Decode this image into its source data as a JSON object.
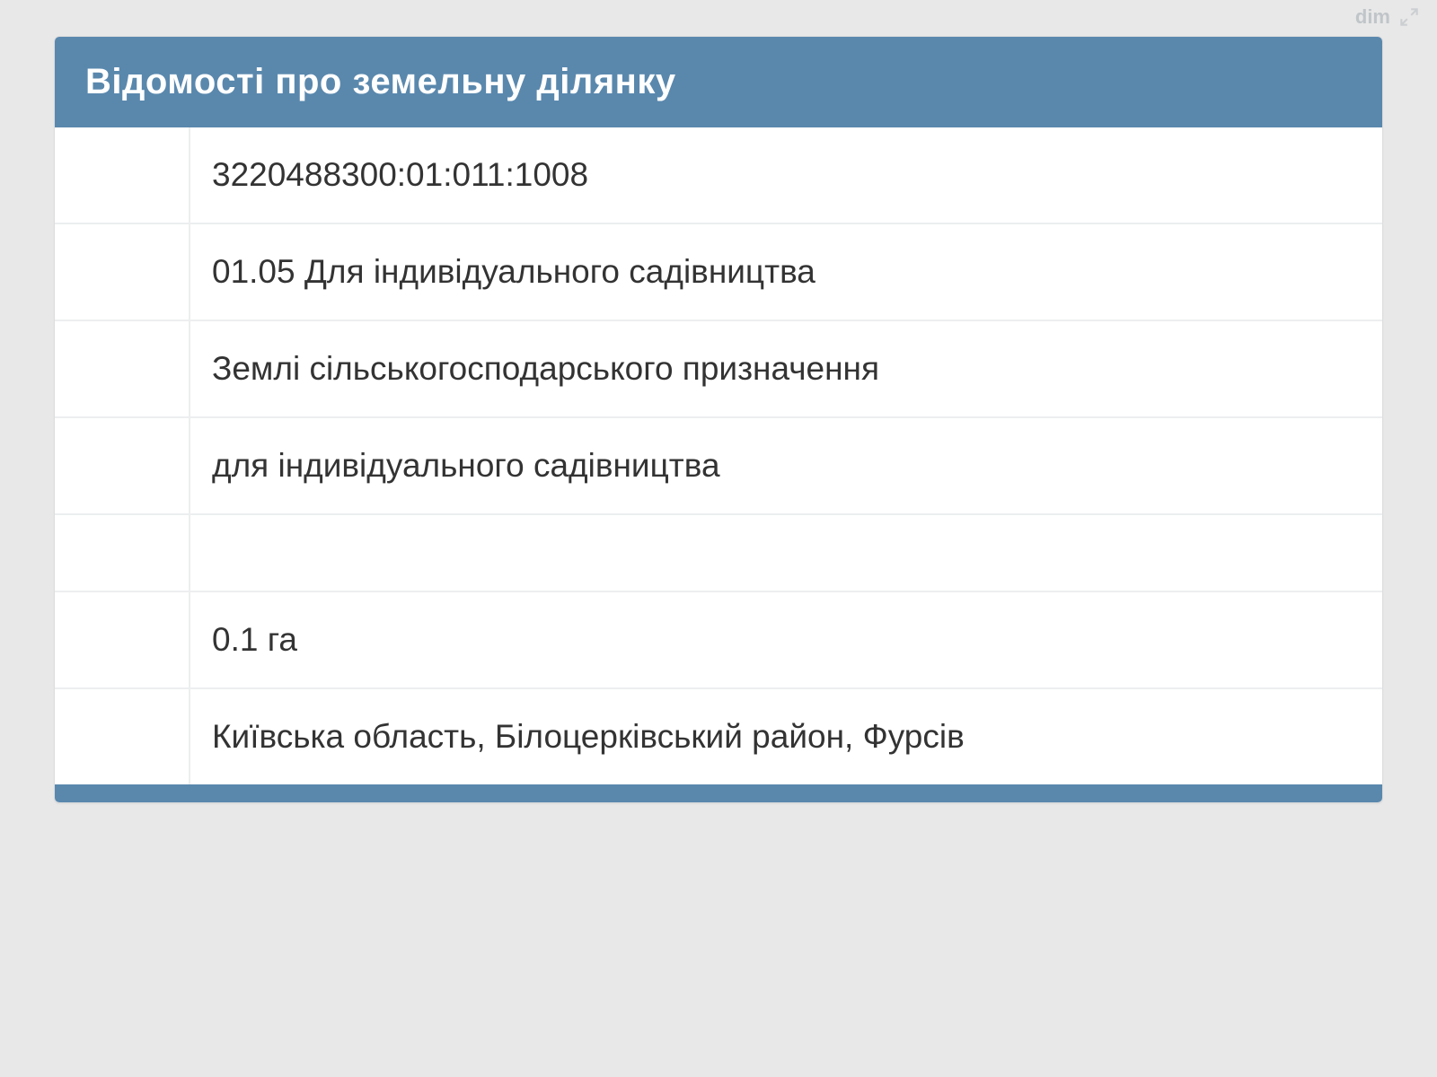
{
  "watermark": {
    "text": "dim"
  },
  "panel": {
    "title": "Відомості про земельну ділянку",
    "rows": [
      {
        "value": "3220488300:01:011:1008"
      },
      {
        "value": "01.05 Для індивідуального садівництва"
      },
      {
        "value": "Землі сільськогосподарського призначення"
      },
      {
        "value": "для індивідуального садівництва"
      },
      {
        "value": ""
      },
      {
        "value": "0.1 га"
      },
      {
        "value": "Київська область, Білоцерківський район, Фурсів"
      }
    ]
  }
}
